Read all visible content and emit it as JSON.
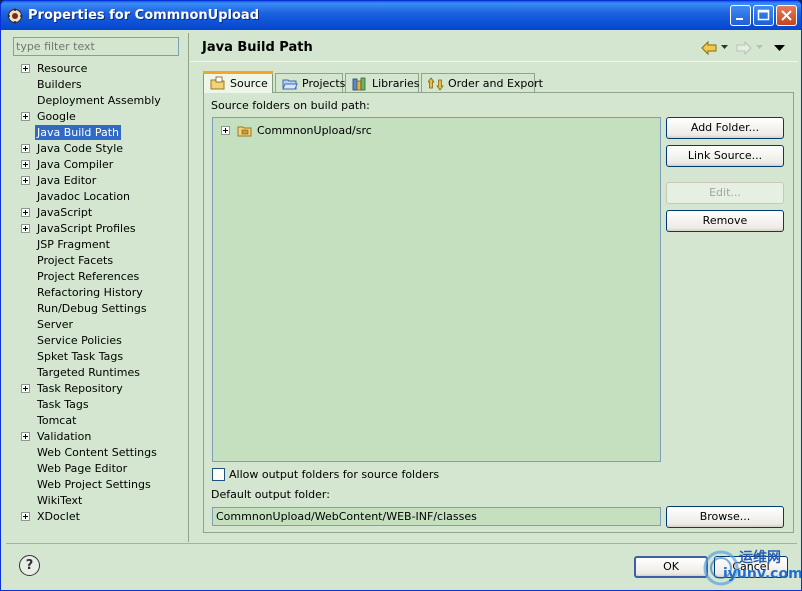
{
  "window": {
    "title": "Properties for CommnonUpload"
  },
  "filter": {
    "placeholder": "type filter text"
  },
  "tree": {
    "items": [
      {
        "label": "Resource",
        "expandable": true
      },
      {
        "label": "Builders",
        "expandable": false
      },
      {
        "label": "Deployment Assembly",
        "expandable": false
      },
      {
        "label": "Google",
        "expandable": true
      },
      {
        "label": "Java Build Path",
        "expandable": false,
        "selected": true
      },
      {
        "label": "Java Code Style",
        "expandable": true
      },
      {
        "label": "Java Compiler",
        "expandable": true
      },
      {
        "label": "Java Editor",
        "expandable": true
      },
      {
        "label": "Javadoc Location",
        "expandable": false
      },
      {
        "label": "JavaScript",
        "expandable": true
      },
      {
        "label": "JavaScript Profiles",
        "expandable": true
      },
      {
        "label": "JSP Fragment",
        "expandable": false
      },
      {
        "label": "Project Facets",
        "expandable": false
      },
      {
        "label": "Project References",
        "expandable": false
      },
      {
        "label": "Refactoring History",
        "expandable": false
      },
      {
        "label": "Run/Debug Settings",
        "expandable": false
      },
      {
        "label": "Server",
        "expandable": false
      },
      {
        "label": "Service Policies",
        "expandable": false
      },
      {
        "label": "Spket Task Tags",
        "expandable": false
      },
      {
        "label": "Targeted Runtimes",
        "expandable": false
      },
      {
        "label": "Task Repository",
        "expandable": true
      },
      {
        "label": "Task Tags",
        "expandable": false
      },
      {
        "label": "Tomcat",
        "expandable": false
      },
      {
        "label": "Validation",
        "expandable": true
      },
      {
        "label": "Web Content Settings",
        "expandable": false
      },
      {
        "label": "Web Page Editor",
        "expandable": false
      },
      {
        "label": "Web Project Settings",
        "expandable": false
      },
      {
        "label": "WikiText",
        "expandable": false
      },
      {
        "label": "XDoclet",
        "expandable": true
      }
    ]
  },
  "page": {
    "title": "Java Build Path"
  },
  "tabs": [
    {
      "label": "Source",
      "active": true,
      "icon": "source-folder-icon"
    },
    {
      "label": "Projects",
      "active": false,
      "icon": "projects-icon"
    },
    {
      "label": "Libraries",
      "active": false,
      "icon": "libraries-icon"
    },
    {
      "label": "Order and Export",
      "active": false,
      "icon": "order-export-icon"
    }
  ],
  "source": {
    "heading": "Source folders on build path:",
    "folders": [
      {
        "label": "CommnonUpload/src"
      }
    ],
    "buttons": {
      "add_folder": "Add Folder...",
      "link_source": "Link Source...",
      "edit": "Edit...",
      "remove": "Remove"
    },
    "allow_output_label": "Allow output folders for source folders",
    "allow_output_checked": false,
    "default_output_label": "Default output folder:",
    "default_output_value": "CommnonUpload/WebContent/WEB-INF/classes",
    "browse": "Browse..."
  },
  "footer": {
    "help": "?",
    "ok": "OK",
    "cancel": "Cancel"
  },
  "watermark": {
    "cn": "运维网",
    "url": "iyunv.com"
  },
  "colors": {
    "background": "#d4e6cf",
    "titlebar": "#0a4fd4",
    "selection": "#316ac5",
    "tab_accent": "#f5a623"
  }
}
